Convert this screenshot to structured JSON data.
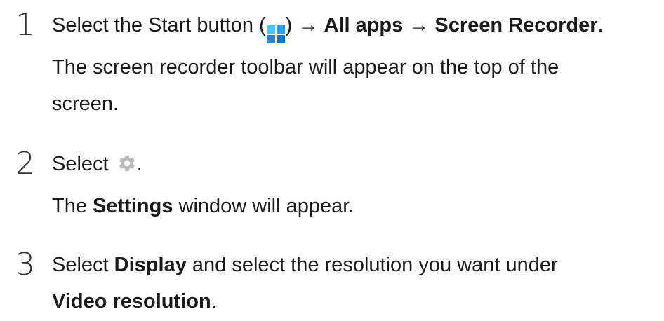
{
  "steps": [
    {
      "number": "1",
      "instruction": {
        "before_icon": "Select the Start button (",
        "icon": "windows-start-icon",
        "after_icon": ") → ",
        "bold1": "All apps",
        "mid": " → ",
        "bold2": "Screen Recorder",
        "end": "."
      },
      "note": {
        "line1": "The screen recorder toolbar will appear on the top of the",
        "line2": "screen."
      }
    },
    {
      "number": "2",
      "instruction": {
        "before_icon": "Select ",
        "icon": "gear-icon",
        "end": "."
      },
      "note": {
        "prefix": "The ",
        "bold": "Settings",
        "suffix": " window will appear."
      }
    },
    {
      "number": "3",
      "instruction": {
        "prefix": "Select ",
        "bold1": "Display",
        "mid": " and select the resolution you want under",
        "bold2": "Video resolution",
        "end": "."
      }
    }
  ],
  "colors": {
    "windows_blue_light": "#4cc2ff",
    "windows_blue_dark": "#0078d4",
    "gear_gray": "#b9b9b9"
  }
}
